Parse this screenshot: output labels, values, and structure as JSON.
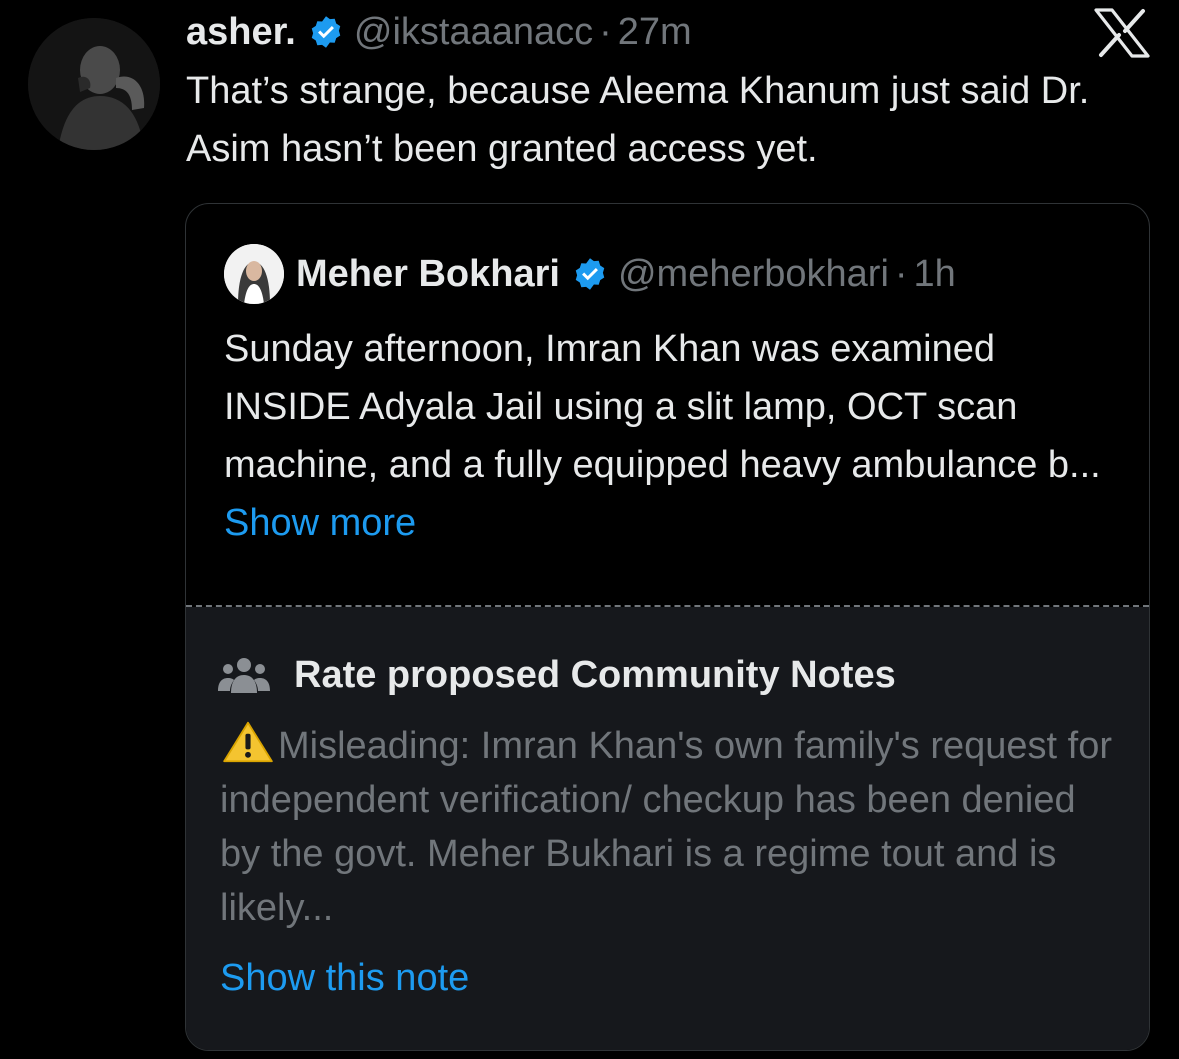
{
  "tweet": {
    "author_name": "asher.",
    "handle": "@ikstaaanacc",
    "separator": "·",
    "time": "27m",
    "text": "That’s strange, because Aleema Khanum just said Dr. Asim hasn’t been granted access yet."
  },
  "quoted_tweet": {
    "author_name": "Meher Bokhari",
    "handle": "@meherbokhari",
    "separator": "·",
    "time": "1h",
    "text": "Sunday afternoon, Imran Khan was examined INSIDE Adyala Jail using a slit lamp, OCT scan machine, and a fully equipped heavy ambulance b...",
    "show_more_label": "Show more"
  },
  "community_notes": {
    "header": "Rate proposed Community Notes",
    "note_text": "Misleading: Imran Khan's own family's request for independent verification/ checkup has been denied by the govt. Meher Bukhari is a regime tout and is likely...",
    "show_note_label": "Show this note"
  },
  "icons": {
    "verified": "verified-badge-icon",
    "brand": "x-logo-icon",
    "notes": "people-icon",
    "warning": "warning-icon"
  },
  "colors": {
    "background": "#000000",
    "text": "#e7e9ea",
    "muted": "#71767b",
    "link": "#1d9bf0",
    "verified": "#1d9bf0",
    "notes_panel": "#16181c"
  }
}
